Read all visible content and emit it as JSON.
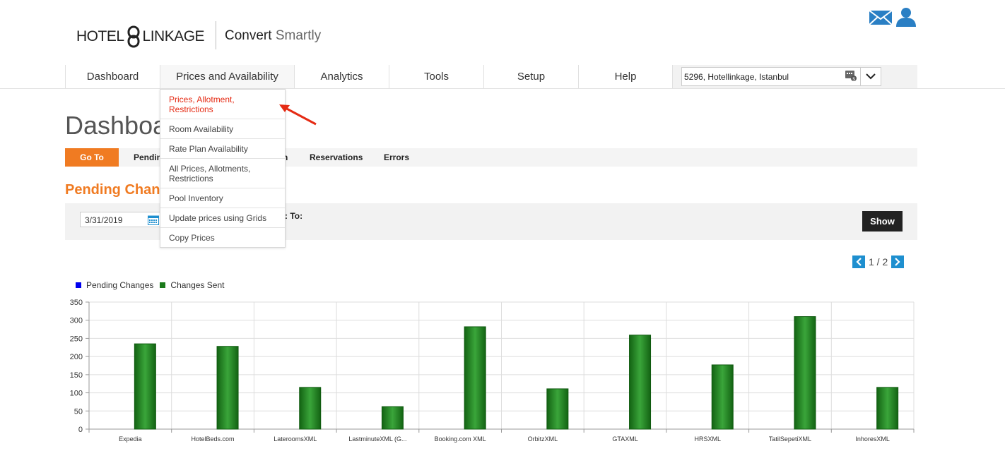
{
  "header": {
    "logo": {
      "left": "HOTEL",
      "right": "LINKAGE"
    },
    "tagline": {
      "strong": "Convert",
      "light": "Smartly"
    },
    "icons": [
      "mail-icon",
      "user-icon"
    ]
  },
  "nav": {
    "items": [
      {
        "label": "Dashboard"
      },
      {
        "label": "Prices and Availability"
      },
      {
        "label": "Analytics"
      },
      {
        "label": "Tools"
      },
      {
        "label": "Setup"
      },
      {
        "label": "Help"
      }
    ],
    "hotel_selector": {
      "value": "5296, Hotellinkage, Istanbul"
    }
  },
  "dropdown": {
    "items": [
      {
        "label": "Prices, Allotment, Restrictions",
        "active": true
      },
      {
        "label": "Room Availability"
      },
      {
        "label": "Rate Plan Availability"
      },
      {
        "label": "All Prices, Allotments, Restrictions"
      },
      {
        "label": "Pool Inventory"
      },
      {
        "label": "Update prices using Grids"
      },
      {
        "label": "Copy Prices"
      }
    ]
  },
  "page": {
    "title": "Dashboard",
    "goto": {
      "button": "Go To",
      "links": [
        "Pending",
        "Reservations",
        "Errors"
      ],
      "link_partial": "n"
    },
    "section_title": "Pending Changes",
    "filter": {
      "date": "3/31/2019",
      "to_label": ": To:",
      "show_button": "Show"
    },
    "pager": {
      "text": "1 / 2"
    }
  },
  "chart_data": {
    "type": "bar",
    "categories": [
      "Expedia",
      "HotelBeds.com",
      "LateroomsXML",
      "LastminuteXML (G...",
      "Booking.com XML",
      "OrbitzXML",
      "GTAXML",
      "HRSXML",
      "TatilSepetiXML",
      "InhoresXML"
    ],
    "series": [
      {
        "name": "Pending Changes",
        "color": "#0000ee",
        "values": [
          0,
          0,
          0,
          0,
          0,
          0,
          0,
          0,
          0,
          0
        ]
      },
      {
        "name": "Changes Sent",
        "color": "#1a7a1a",
        "values": [
          235,
          228,
          115,
          62,
          282,
          111,
          259,
          177,
          310,
          115
        ]
      }
    ],
    "ylim": [
      0,
      350
    ],
    "yticks": [
      0,
      50,
      100,
      150,
      200,
      250,
      300,
      350
    ],
    "grid": true,
    "legend": "top-left"
  },
  "colors": {
    "accent": "#f07b22",
    "pager": "#1e8fcf",
    "menu_active": "#e52b14",
    "dark_button": "#222222"
  }
}
